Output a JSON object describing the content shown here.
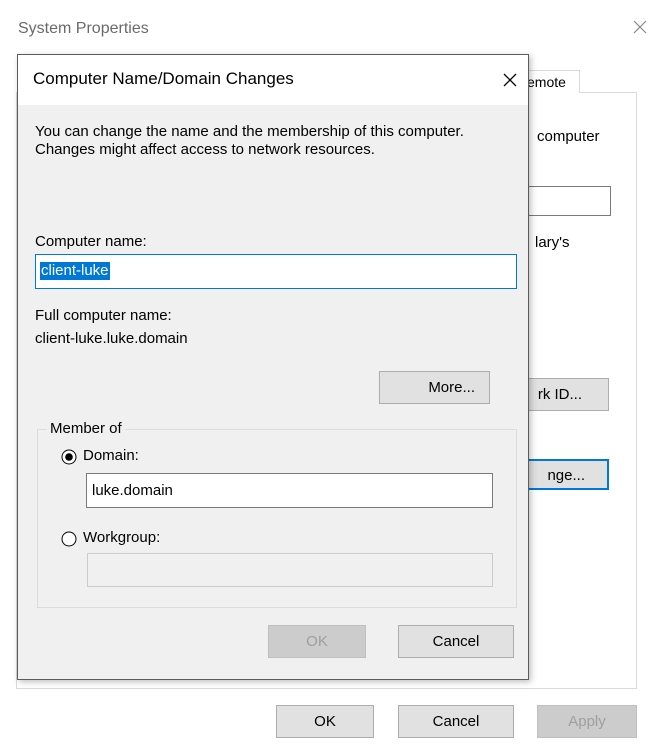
{
  "parent_window": {
    "title": "System Properties",
    "tab_partial": "emote",
    "partial_text_computer": "computer",
    "partial_text_larys": "lary's",
    "network_id_button_partial": "rk ID...",
    "change_button_partial": "nge...",
    "ok_label": "OK",
    "cancel_label": "Cancel",
    "apply_label": "Apply"
  },
  "dialog": {
    "title": "Computer Name/Domain Changes",
    "description": "You can change the name and the membership of this computer. Changes might affect access to network resources.",
    "computer_name_label": "Computer name:",
    "computer_name_value": "client-luke",
    "full_name_label": "Full computer name:",
    "full_name_value": "client-luke.luke.domain",
    "more_button_label": "More...",
    "member_of_label": "Member of",
    "domain_label": "Domain:",
    "domain_value": "luke.domain",
    "domain_selected": true,
    "workgroup_label": "Workgroup:",
    "workgroup_value": "",
    "ok_label": "OK",
    "cancel_label": "Cancel"
  },
  "colors": {
    "accent": "#0078d7",
    "button_bg": "#e1e1e1",
    "dialog_bg": "#f0f0f0"
  },
  "icons": {
    "close": "close-icon",
    "radio_selected": "radio-checked-icon",
    "radio_unselected": "radio-unchecked-icon"
  }
}
